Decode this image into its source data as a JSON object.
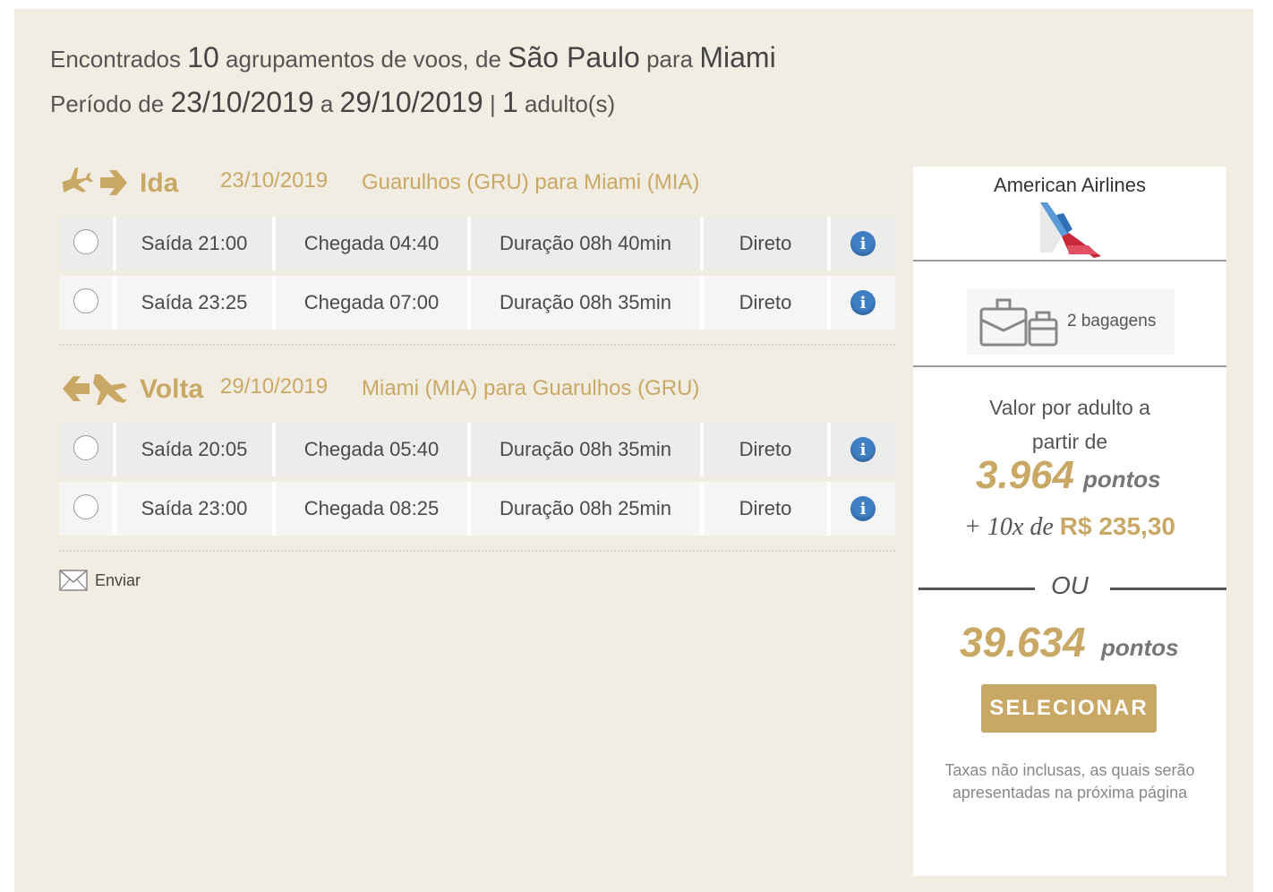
{
  "summary": {
    "line1_prefix": "Encontrados",
    "count": "10",
    "line1_mid": "agrupamentos de voos, de",
    "origin": "São Paulo",
    "line1_to": "para",
    "destination": "Miami",
    "line2_prefix": "Período de",
    "date_from": "23/10/2019",
    "line2_a": "a",
    "date_to": "29/10/2019",
    "separator": "|",
    "adults": "1",
    "adults_label": "adulto(s)"
  },
  "outbound": {
    "label": "Ida",
    "date": "23/10/2019",
    "route": "Guarulhos (GRU) para Miami (MIA)",
    "flights": [
      {
        "departure": "Saída 21:00",
        "arrival": "Chegada 04:40",
        "duration": "Duração 08h 40min",
        "stops": "Direto"
      },
      {
        "departure": "Saída 23:25",
        "arrival": "Chegada 07:00",
        "duration": "Duração 08h 35min",
        "stops": "Direto"
      }
    ]
  },
  "inbound": {
    "label": "Volta",
    "date": "29/10/2019",
    "route": "Miami (MIA) para Guarulhos (GRU)",
    "flights": [
      {
        "departure": "Saída 20:05",
        "arrival": "Chegada 05:40",
        "duration": "Duração 08h 35min",
        "stops": "Direto"
      },
      {
        "departure": "Saída 23:00",
        "arrival": "Chegada 08:25",
        "duration": "Duração 08h 25min",
        "stops": "Direto"
      }
    ]
  },
  "send_label": "Enviar",
  "side": {
    "airline": "American Airlines",
    "bags": "2 bagagens",
    "price_label": "Valor por adulto a partir de",
    "points_combo": "3.964",
    "points_word": "pontos",
    "installment_prefix": "+ 10x de",
    "installment_amount": "R$ 235,30",
    "or": "OU",
    "points_full": "39.634",
    "select_label": "SELECIONAR",
    "note": "Taxas não inclusas, as quais serão apresentadas na próxima página"
  },
  "colors": {
    "gold": "#c9a865",
    "panel_bg": "#f2ede3",
    "info_blue": "#3f7fc4"
  },
  "icons": {
    "outbound": "plane-right-arrow-icon",
    "inbound": "arrow-left-plane-icon",
    "info": "info-icon",
    "send": "envelope-icon",
    "bags": "luggage-icon",
    "airline": "american-airlines-logo"
  }
}
